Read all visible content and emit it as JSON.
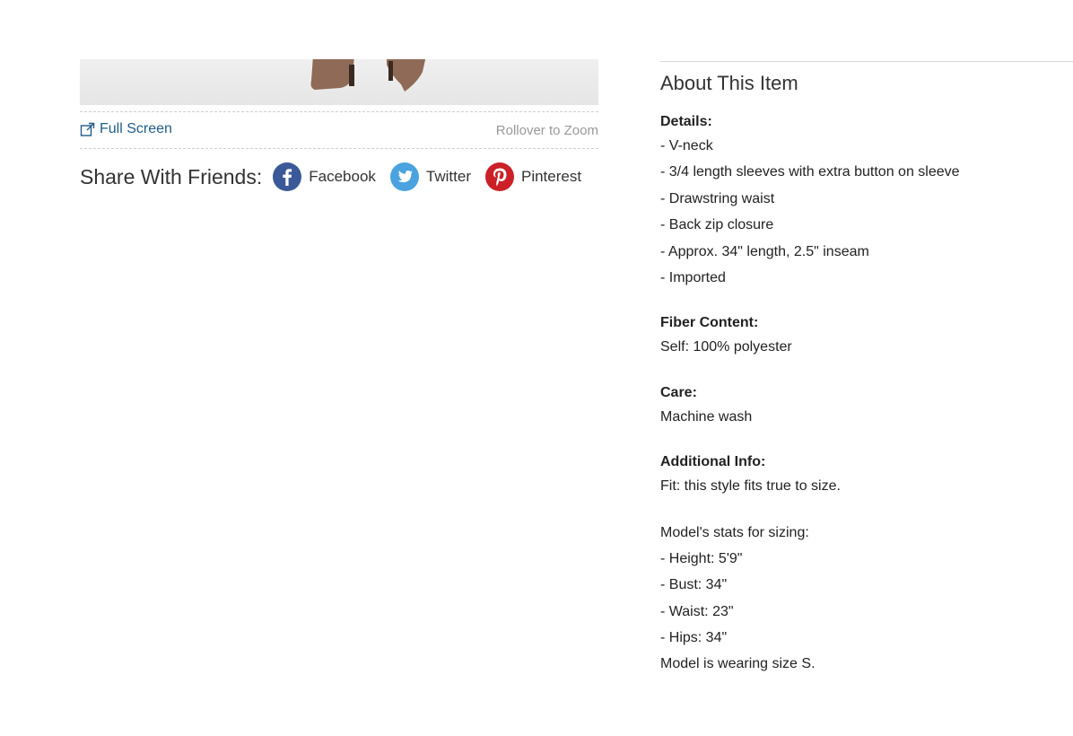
{
  "gallery": {
    "full_screen_label": "Full Screen",
    "rollover_label": "Rollover to Zoom"
  },
  "share": {
    "title": "Share With Friends:",
    "networks": [
      {
        "label": "Facebook",
        "icon": "facebook-icon",
        "color": "#3b5998"
      },
      {
        "label": "Twitter",
        "icon": "twitter-icon",
        "color": "#4aa3df"
      },
      {
        "label": "Pinterest",
        "icon": "pinterest-icon",
        "color": "#cb2027"
      }
    ]
  },
  "about": {
    "title": "About This Item",
    "details": {
      "heading": "Details:",
      "items": [
        "- V-neck",
        "- 3/4 length sleeves with extra button on sleeve",
        "- Drawstring waist",
        "- Back zip closure",
        "- Approx. 34\" length, 2.5\" inseam",
        "- Imported"
      ]
    },
    "fiber": {
      "heading": "Fiber Content:",
      "text": "Self: 100% polyester"
    },
    "care": {
      "heading": "Care:",
      "text": "Machine wash"
    },
    "additional": {
      "heading": "Additional Info:",
      "fit": "Fit: this style fits true to size.",
      "model_heading": "Model's stats for sizing:",
      "stats": [
        "- Height: 5'9\"",
        "- Bust: 34\"",
        "- Waist: 23\"",
        "- Hips: 34\""
      ],
      "wearing": "Model is wearing size S."
    }
  },
  "colors": {
    "link": "#1f5d8a",
    "muted": "#999999",
    "boot": "#8f6a56"
  }
}
